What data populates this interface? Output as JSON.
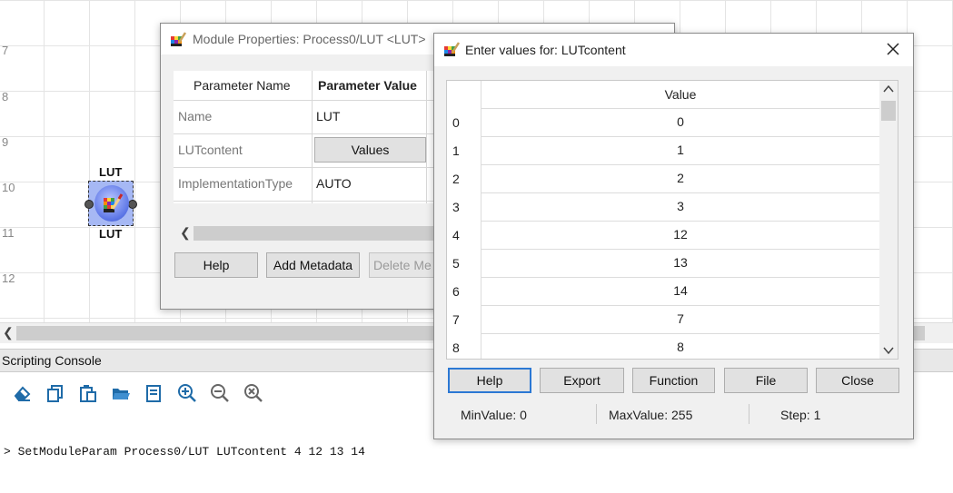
{
  "ruler": [
    "7",
    "8",
    "9",
    "10",
    "11",
    "12"
  ],
  "module": {
    "label_top": "LUT",
    "label_bottom": "LUT"
  },
  "console": {
    "title": "Scripting Console",
    "toolbar": [
      "eraser-icon",
      "copy-icon",
      "paste-icon",
      "open-folder-icon",
      "book-icon",
      "zoom-in-icon",
      "zoom-out-icon",
      "zoom-reset-icon"
    ],
    "command": "> SetModuleParam Process0/LUT LUTcontent 4 12 13 14"
  },
  "module_properties": {
    "title": "Module Properties: Process0/LUT <LUT>",
    "headers": {
      "name": "Parameter Name",
      "value": "Parameter Value"
    },
    "rows": [
      {
        "name": "Name",
        "value": "LUT"
      },
      {
        "name": "LUTcontent",
        "value": "Values"
      },
      {
        "name": "ImplementationType",
        "value": "AUTO"
      }
    ],
    "buttons": {
      "help": "Help",
      "add_metadata": "Add Metadata",
      "delete_metadata": "Delete Me"
    }
  },
  "enter_values": {
    "title": "Enter values for: LUTcontent",
    "column_header": "Value",
    "rows": [
      {
        "index": "0",
        "value": "0"
      },
      {
        "index": "1",
        "value": "1"
      },
      {
        "index": "2",
        "value": "2"
      },
      {
        "index": "3",
        "value": "3"
      },
      {
        "index": "4",
        "value": "12"
      },
      {
        "index": "5",
        "value": "13"
      },
      {
        "index": "6",
        "value": "14"
      },
      {
        "index": "7",
        "value": "7"
      },
      {
        "index": "8",
        "value": "8"
      }
    ],
    "buttons": {
      "help": "Help",
      "export": "Export",
      "function": "Function",
      "file": "File",
      "close": "Close"
    },
    "status": {
      "min": "MinValue: 0",
      "max": "MaxValue: 255",
      "step": "Step: 1"
    }
  },
  "colors": {
    "accent": "#2b78d4",
    "module_fill": "#a6b8f4",
    "toolbar_icon": "#1f6ba8"
  }
}
